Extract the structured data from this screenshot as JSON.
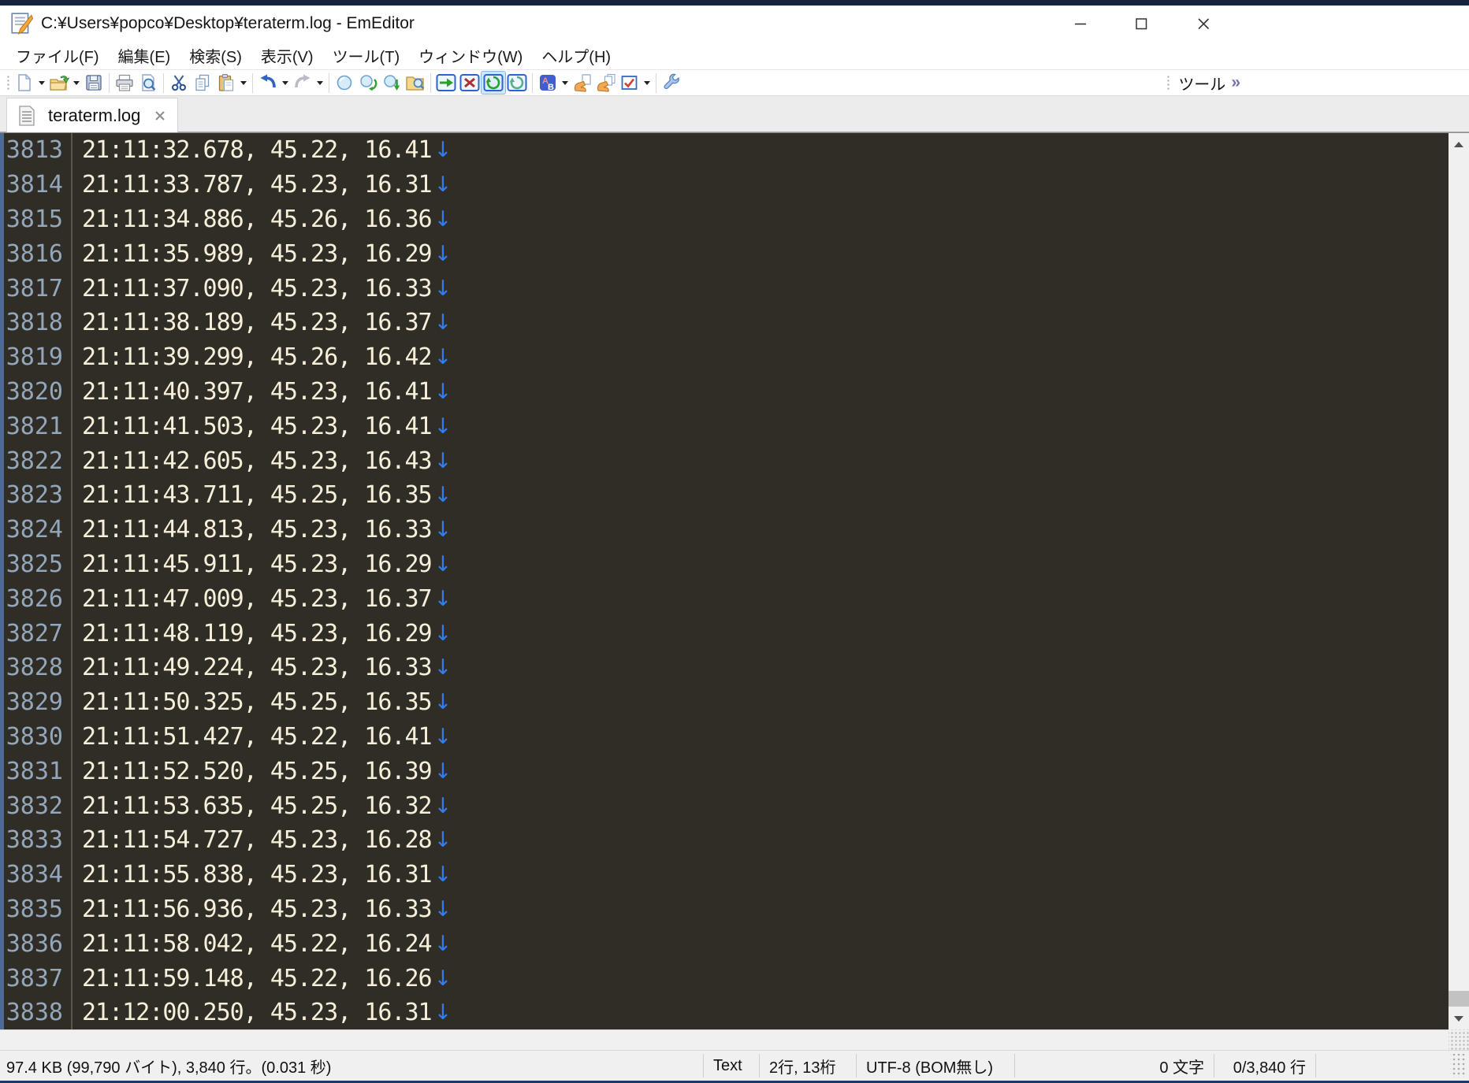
{
  "window": {
    "title": "C:¥Users¥popco¥Desktop¥teraterm.log - EmEditor",
    "app_name": "EmEditor"
  },
  "menu": {
    "items": [
      {
        "id": "file",
        "label": "ファイル(F)"
      },
      {
        "id": "edit",
        "label": "編集(E)"
      },
      {
        "id": "search",
        "label": "検索(S)"
      },
      {
        "id": "view",
        "label": "表示(V)"
      },
      {
        "id": "tools",
        "label": "ツール(T)"
      },
      {
        "id": "window",
        "label": "ウィンドウ(W)"
      },
      {
        "id": "help",
        "label": "ヘルプ(H)"
      }
    ]
  },
  "toolbar": {
    "overflow_label": "ツール",
    "overflow_chevron": "»",
    "active_icon": "wrap-by-window",
    "icons": [
      "new-file",
      "new-file-dropdown",
      "open-file",
      "open-file-dropdown",
      "save",
      "print",
      "print-preview",
      "cut",
      "copy",
      "paste",
      "paste-dropdown",
      "undo",
      "undo-dropdown",
      "redo",
      "redo-dropdown",
      "find",
      "find-next",
      "find-previous",
      "find-in-files",
      "wrap-none",
      "wrap-by-characters",
      "wrap-by-window",
      "wrap-by-page",
      "sort",
      "sort-dropdown",
      "tag-jump",
      "direct-tag-jump",
      "macro-record",
      "macro-dropdown",
      "customize"
    ]
  },
  "tabs": [
    {
      "label": "teraterm.log",
      "active": true
    }
  ],
  "editor": {
    "newline_mark": "↓",
    "lines": [
      {
        "num": "3813",
        "text": "21:11:32.678, 45.22, 16.41"
      },
      {
        "num": "3814",
        "text": "21:11:33.787, 45.23, 16.31"
      },
      {
        "num": "3815",
        "text": "21:11:34.886, 45.26, 16.36"
      },
      {
        "num": "3816",
        "text": "21:11:35.989, 45.23, 16.29"
      },
      {
        "num": "3817",
        "text": "21:11:37.090, 45.23, 16.33"
      },
      {
        "num": "3818",
        "text": "21:11:38.189, 45.23, 16.37"
      },
      {
        "num": "3819",
        "text": "21:11:39.299, 45.26, 16.42"
      },
      {
        "num": "3820",
        "text": "21:11:40.397, 45.23, 16.41"
      },
      {
        "num": "3821",
        "text": "21:11:41.503, 45.23, 16.41"
      },
      {
        "num": "3822",
        "text": "21:11:42.605, 45.23, 16.43"
      },
      {
        "num": "3823",
        "text": "21:11:43.711, 45.25, 16.35"
      },
      {
        "num": "3824",
        "text": "21:11:44.813, 45.23, 16.33"
      },
      {
        "num": "3825",
        "text": "21:11:45.911, 45.23, 16.29"
      },
      {
        "num": "3826",
        "text": "21:11:47.009, 45.23, 16.37"
      },
      {
        "num": "3827",
        "text": "21:11:48.119, 45.23, 16.29"
      },
      {
        "num": "3828",
        "text": "21:11:49.224, 45.23, 16.33"
      },
      {
        "num": "3829",
        "text": "21:11:50.325, 45.25, 16.35"
      },
      {
        "num": "3830",
        "text": "21:11:51.427, 45.22, 16.41"
      },
      {
        "num": "3831",
        "text": "21:11:52.520, 45.25, 16.39"
      },
      {
        "num": "3832",
        "text": "21:11:53.635, 45.25, 16.32"
      },
      {
        "num": "3833",
        "text": "21:11:54.727, 45.23, 16.28"
      },
      {
        "num": "3834",
        "text": "21:11:55.838, 45.23, 16.31"
      },
      {
        "num": "3835",
        "text": "21:11:56.936, 45.23, 16.33"
      },
      {
        "num": "3836",
        "text": "21:11:58.042, 45.22, 16.24"
      },
      {
        "num": "3837",
        "text": "21:11:59.148, 45.22, 16.26"
      },
      {
        "num": "3838",
        "text": "21:12:00.250, 45.23, 16.31"
      }
    ]
  },
  "status_bar": {
    "file_info": "97.4 KB (99,790 バイト), 3,840 行。(0.031 秒)",
    "mode": "Text",
    "cursor": "2行, 13桁",
    "encoding": "UTF-8 (BOM無し)",
    "selection": "0 文字",
    "position": "0/3,840 行"
  },
  "colors": {
    "editor_bg": "#302D27",
    "editor_text": "#F6EFD9",
    "line_number": "#93A6BA",
    "newline_mark": "#2E7EF2",
    "chrome_bg": "#FFFFFF",
    "statusbar_bg": "#F0F0F0",
    "window_bottom_border": "#1B3A6B",
    "active_toolbar_highlight": "#CFE7FB"
  }
}
